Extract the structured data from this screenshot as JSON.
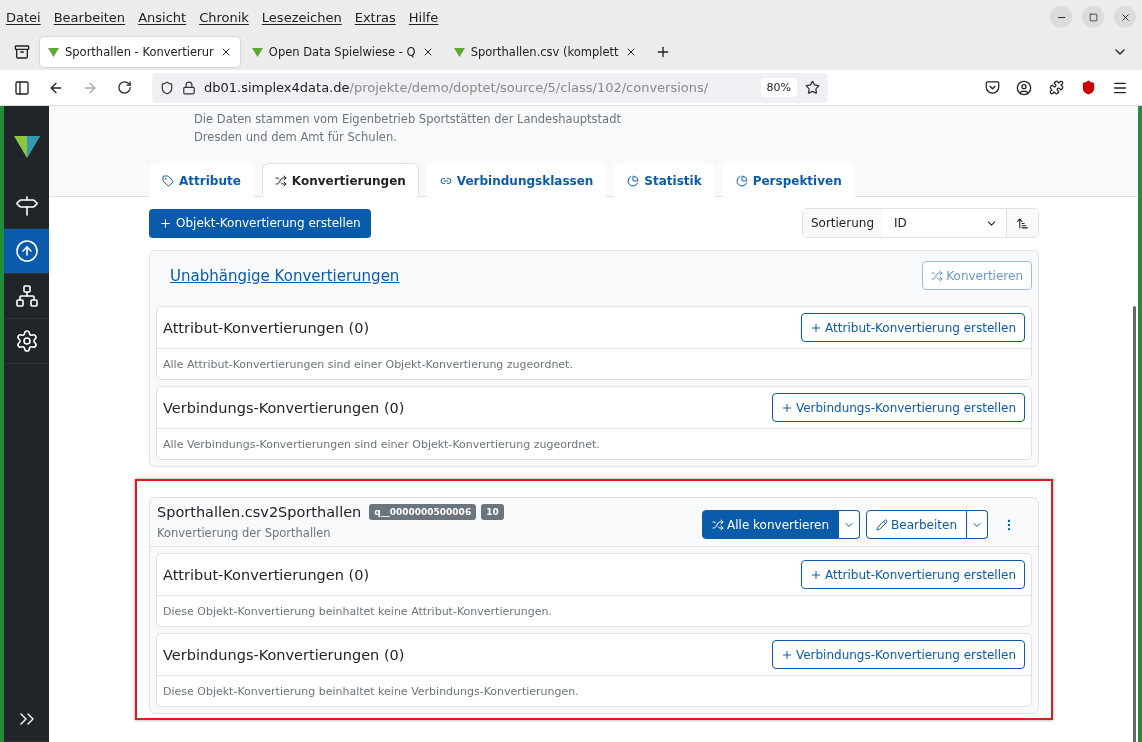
{
  "menu": [
    "Datei",
    "Bearbeiten",
    "Ansicht",
    "Chronik",
    "Lesezeichen",
    "Extras",
    "Hilfe"
  ],
  "browser_tabs": [
    {
      "title": "Sporthallen - Konvertierur",
      "selected": true
    },
    {
      "title": "Open Data Spielwiese - Q",
      "selected": false
    },
    {
      "title": "Sporthallen.csv (komplett",
      "selected": false
    }
  ],
  "address": {
    "host": "db01.simplex4data.de",
    "path": "/projekte/demo/doptet/source/5/class/102/conversions/",
    "zoom": "80%"
  },
  "sidebar": [
    {
      "kind": "signpost",
      "selected": false
    },
    {
      "kind": "upload",
      "selected": true
    },
    {
      "kind": "network",
      "selected": false
    },
    {
      "kind": "settings",
      "selected": false
    }
  ],
  "description": "Die Daten stammen vom Eigenbetrieb Sportstätten der Landeshauptstadt Dresden und dem Amt für Schulen.",
  "tabs": [
    {
      "kind": "tag",
      "label": "Attribute",
      "selected": false
    },
    {
      "kind": "shuffle",
      "label": "Konvertierungen",
      "selected": true
    },
    {
      "kind": "link",
      "label": "Verbindungsklassen",
      "selected": false
    },
    {
      "kind": "pie",
      "label": "Statistik",
      "selected": false
    },
    {
      "kind": "pie",
      "label": "Perspektiven",
      "selected": false
    }
  ],
  "create_button": "Objekt-Konvertierung erstellen",
  "sort": {
    "label": "Sortierung",
    "value": "ID"
  },
  "groups": [
    {
      "kind": "independent",
      "title": "Unabhängige Konvertierungen",
      "action": "Konvertieren",
      "highlighted": false,
      "sections": [
        {
          "title": "Attribut-Konvertierungen (0)",
          "button": "Attribut-Konvertierung erstellen",
          "note": "Alle Attribut-Konvertierungen sind einer Objekt-Konvertierung zugeordnet."
        },
        {
          "title": "Verbindungs-Konvertierungen (0)",
          "button": "Verbindungs-Konvertierung erstellen",
          "note": "Alle Verbindungs-Konvertierungen sind einer Objekt-Konvertierung zugeordnet."
        }
      ]
    },
    {
      "kind": "object",
      "title": "Sporthallen.csv2Sporthallen",
      "badges": [
        "q__0000000500006",
        "10"
      ],
      "subtitle": "Konvertierung der Sporthallen",
      "action": "Alle konvertieren",
      "edit": "Bearbeiten",
      "highlighted": true,
      "sections": [
        {
          "title": "Attribut-Konvertierungen (0)",
          "button": "Attribut-Konvertierung erstellen",
          "note": "Diese Objekt-Konvertierung beinhaltet keine Attribut-Konvertierungen."
        },
        {
          "title": "Verbindungs-Konvertierungen (0)",
          "button": "Verbindungs-Konvertierung erstellen",
          "note": "Diese Objekt-Konvertierung beinhaltet keine Verbindungs-Konvertierungen."
        }
      ]
    }
  ]
}
